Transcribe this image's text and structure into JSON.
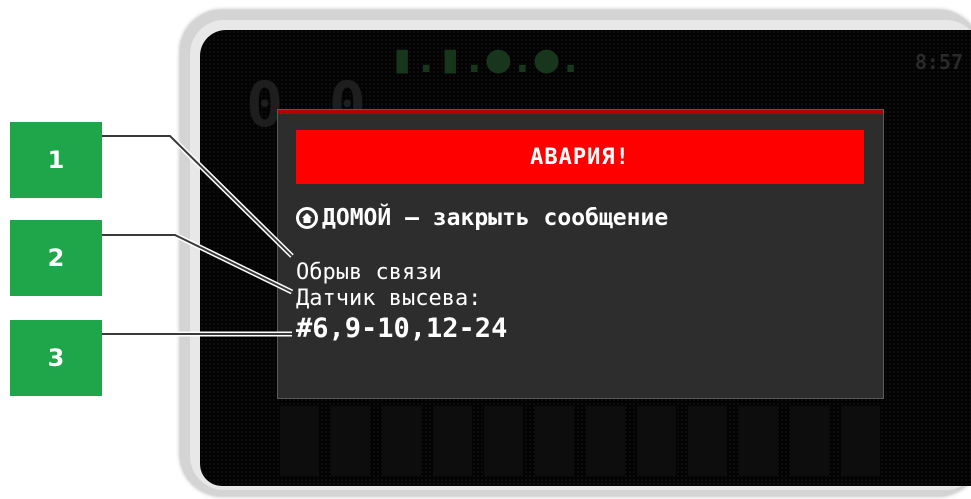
{
  "dialog": {
    "alarm_title": "АВАРИЯ!",
    "home_hint": "ДОМОЙ – закрыть сообщение",
    "message_line1": "Обрыв связи",
    "message_line2": "Датчик высева:",
    "message_line3": "#6,9-10,12-24"
  },
  "callouts": [
    "1",
    "2",
    "3"
  ],
  "background_ghosts": {
    "top_icons": "▮.▮.●.●.",
    "big_value": "0,0",
    "time": "8:57"
  },
  "colors": {
    "alarm_bg": "#ff0000",
    "callout_bg": "#1fa64a",
    "dialog_bg": "#2d2d2d",
    "screen_bg": "#030303"
  }
}
